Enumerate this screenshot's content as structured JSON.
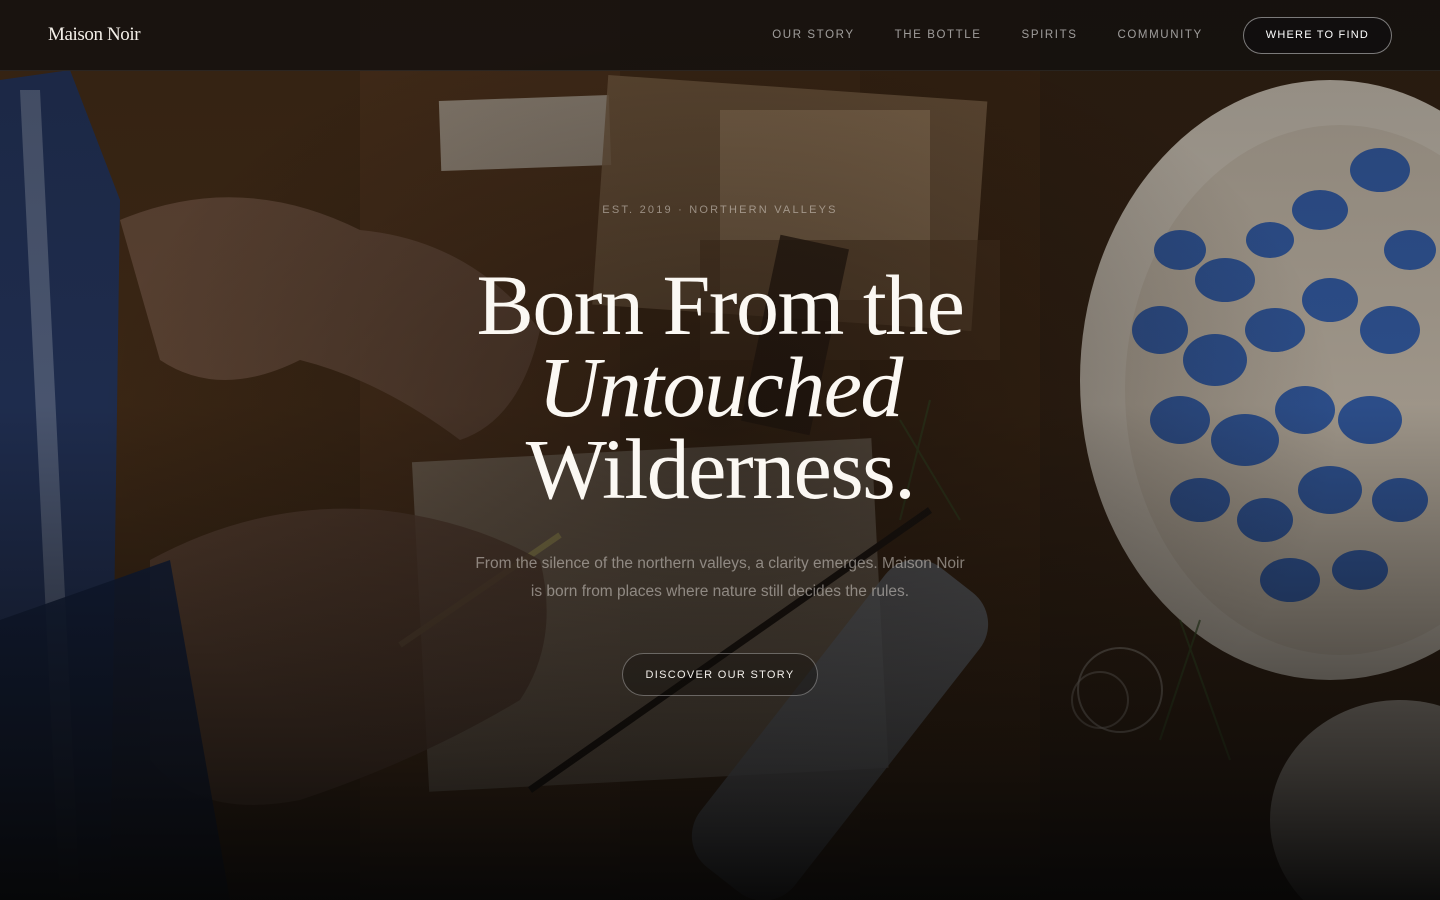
{
  "header": {
    "brand": "Maison Noir",
    "nav": [
      {
        "label": "OUR STORY"
      },
      {
        "label": "THE BOTTLE"
      },
      {
        "label": "SPIRITS"
      },
      {
        "label": "COMMUNITY"
      }
    ],
    "cta_label": "WHERE TO FIND"
  },
  "hero": {
    "eyebrow": "EST. 2019 · NORTHERN VALLEYS",
    "headline_line1": "Born From the",
    "headline_line2": "Untouched",
    "headline_line3": "Wilderness.",
    "subcopy": "From the silence of the northern valleys, a clarity emerges. Maison Noir is born from places where nature still decides the rules.",
    "cta_label": "DISCOVER OUR STORY"
  },
  "colors": {
    "text": "#fbf8f3",
    "muted": "#d7d2cc",
    "accent_blue": "#2f5fb4",
    "wood": "#5a3a22"
  }
}
